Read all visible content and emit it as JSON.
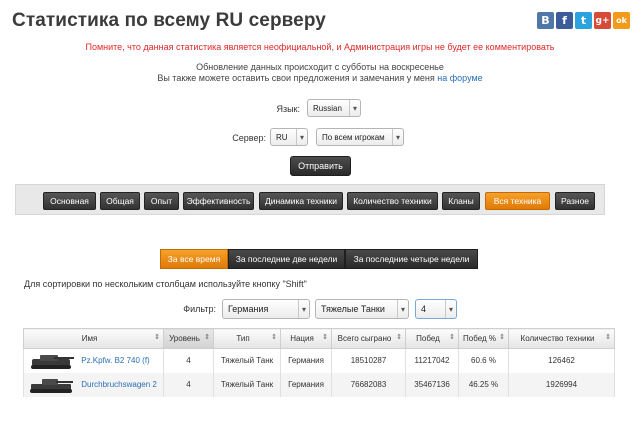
{
  "header": {
    "title": "Статистика по всему RU серверу",
    "social": [
      {
        "label": "B",
        "color": "#4f77a8"
      },
      {
        "label": "f",
        "color": "#3b5b9a"
      },
      {
        "label": "t",
        "color": "#2aa3de"
      },
      {
        "label": "g+",
        "color": "#d74a38"
      },
      {
        "label": "ok",
        "color": "#f39a1b"
      }
    ]
  },
  "notices": {
    "warning": "Помните, что данная статистика является неофициальной, и Администрация игры не будет ее комментировать",
    "update": "Обновление данных происходит с субботы на воскресенье",
    "suggest": "Вы также можете оставить свои предложения и замечания у меня",
    "forum_link": "на форуме"
  },
  "form": {
    "lang_label": "Язык:",
    "lang_value": "Russian",
    "server_label": "Сервер:",
    "server_value": "RU",
    "players_value": "По всем игрокам",
    "submit_label": "Отправить"
  },
  "tabs": [
    {
      "label": "Основная",
      "active": false
    },
    {
      "label": "Общая",
      "active": false
    },
    {
      "label": "Опыт",
      "active": false
    },
    {
      "label": "Эффективность",
      "active": false
    },
    {
      "label": "Динамика техники",
      "active": false
    },
    {
      "label": "Количество техники",
      "active": false
    },
    {
      "label": "Кланы",
      "active": false
    },
    {
      "label": "Вся техника",
      "active": true
    },
    {
      "label": "Разное",
      "active": false
    }
  ],
  "periods": [
    {
      "label": "За все время",
      "active": true
    },
    {
      "label": "За последние две недели",
      "active": false
    },
    {
      "label": "За последние четыре недели",
      "active": false
    }
  ],
  "hint": "Для сортировки по нескольким столбцам используйте кнопку \"Shift\"",
  "filter": {
    "label": "Фильтр:",
    "nation": "Германия",
    "type": "Тяжелые Танки",
    "level": "4"
  },
  "table": {
    "columns": [
      "Имя",
      "Уровень",
      "Тип",
      "Нация",
      "Всего сыграно",
      "Побед",
      "Побед %",
      "Количество техники"
    ],
    "rows": [
      {
        "name": "Pz.Kpfw. B2 740 (f)",
        "level": "4",
        "type": "Тяжелый Танк",
        "nation": "Германия",
        "played": "18510287",
        "wins": "11217042",
        "win_pct": "60.6 %",
        "count": "126462"
      },
      {
        "name": "Durchbruchswagen 2",
        "level": "4",
        "type": "Тяжелый Танк",
        "nation": "Германия",
        "played": "76682083",
        "wins": "35467136",
        "win_pct": "46.25 %",
        "count": "1926994"
      }
    ]
  }
}
